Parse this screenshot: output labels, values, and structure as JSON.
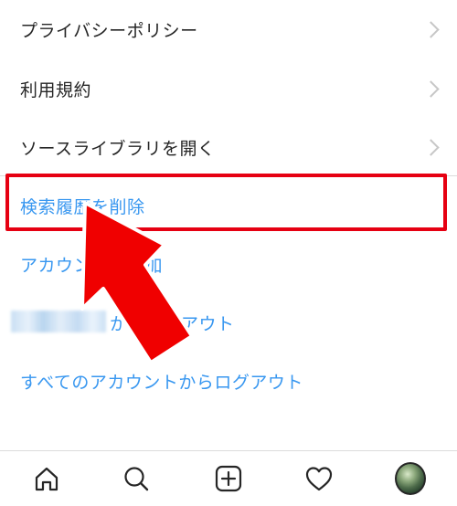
{
  "menu": {
    "privacy_policy": "プライバシーポリシー",
    "terms": "利用規約",
    "open_source": "ソースライブラリを開く",
    "delete_history": "検索履歴を削除",
    "add_account": "アカウントを追加",
    "logout_account_suffix": "からログアウト",
    "logout_all": "すべてのアカウントからログアウト"
  },
  "icons": {
    "home": "home-icon",
    "search": "search-icon",
    "add": "add-post-icon",
    "activity": "heart-icon",
    "profile": "profile-avatar"
  },
  "colors": {
    "link_blue": "#3897f0",
    "highlight_red": "#e60012",
    "text": "#262626"
  }
}
